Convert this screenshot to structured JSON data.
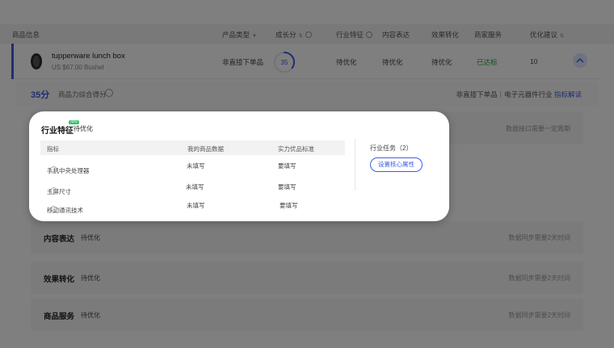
{
  "table_header": {
    "product_info": "商品信息",
    "product_type": "产品类型",
    "growth_score": "成长分",
    "industry_feature": "行业特征",
    "content_expression": "内容表达",
    "effect_conversion": "效果转化",
    "merchant_service": "商家服务",
    "optimize_suggestion": "优化建议"
  },
  "product": {
    "name": "tupperware lunch box",
    "price": "US $67.00 Bushel",
    "type": "非直接下单品",
    "score": "35",
    "score_fraction": 0.35,
    "industry_feature": "待优化",
    "content_expression": "待优化",
    "effect_conversion": "待优化",
    "merchant_service": "已达标",
    "optimize_suggestion": "10"
  },
  "summary": {
    "score": "35分",
    "label": "商品力综合得分",
    "category_prefix": "非直接下单品｜电子元器件行业",
    "link": "指标解读"
  },
  "card": {
    "title": "行业特征",
    "badge": "NEW",
    "status": "待优化",
    "columns": [
      "指标",
      "我的商品数据",
      "实力优品标准"
    ],
    "rows": [
      {
        "metric": "手机中央处理器",
        "my_data": "未填写",
        "standard": "要填写"
      },
      {
        "metric": "主屏尺寸",
        "my_data": "未填写",
        "standard": "要填写"
      },
      {
        "metric": "移动通讯技术",
        "my_data": "未填写",
        "standard": "要填写"
      }
    ],
    "task_title": "行业任务（2）",
    "task_button": "设置核心属性"
  },
  "sections": [
    {
      "title": "内容表达",
      "status": "待优化",
      "note": "数据同步需要2天时间"
    },
    {
      "title": "效果转化",
      "status": "待优化",
      "note": "数据同步需要2天时间"
    },
    {
      "title": "商品服务",
      "status": "待优化",
      "note": "数据同步需要2天时间"
    }
  ],
  "hidden_note": "数据接口需要一定周期",
  "colors": {
    "accent": "#3d5ce8",
    "success": "#22a043",
    "badge": "#36c26a"
  }
}
